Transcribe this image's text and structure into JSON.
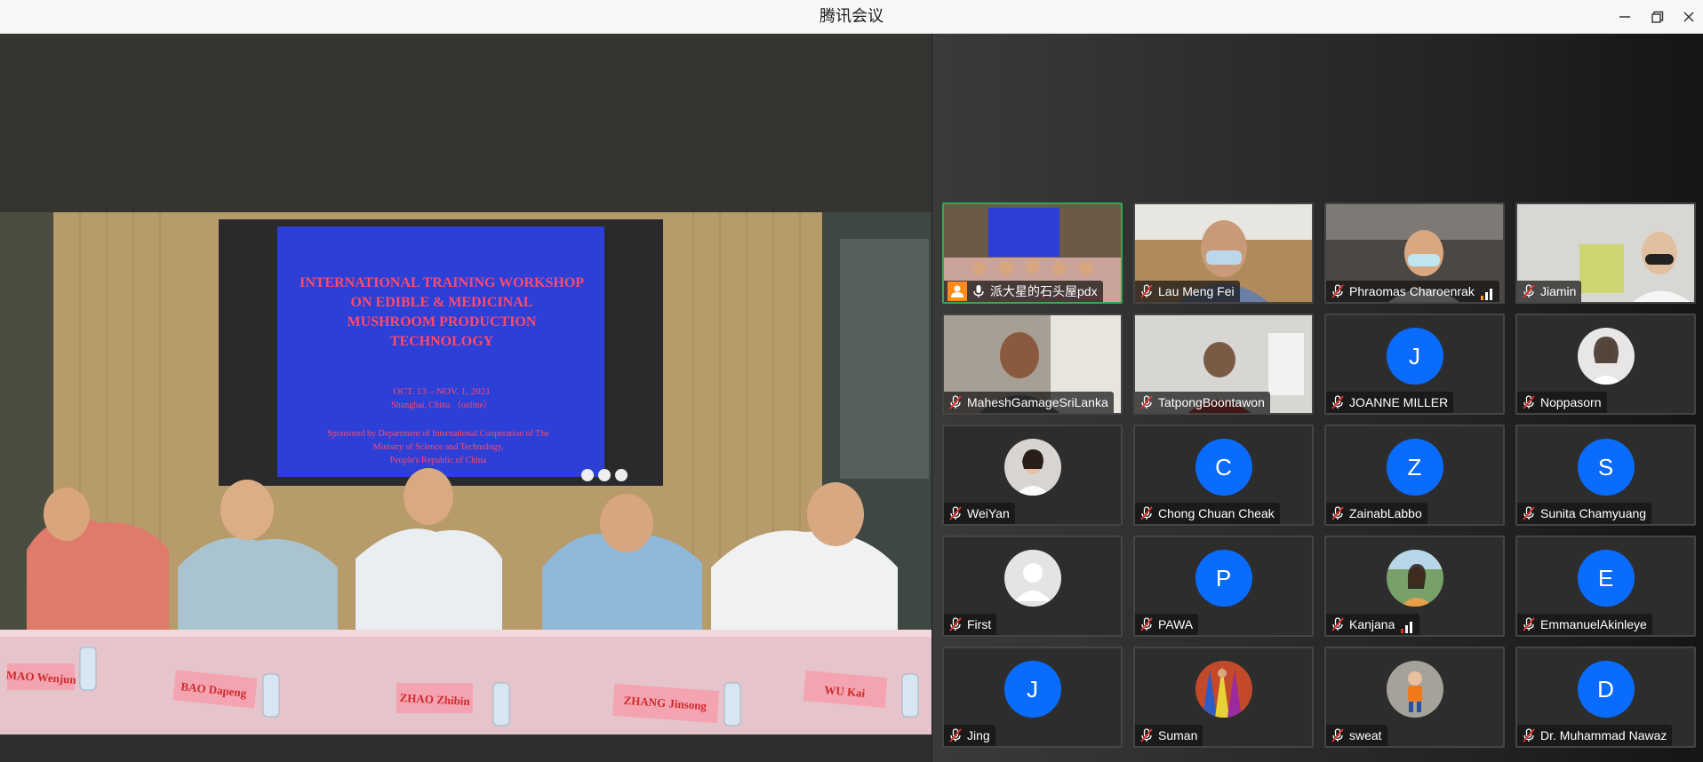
{
  "window": {
    "title": "腾讯会议"
  },
  "slide": {
    "title_lines": [
      "INTERNATIONAL TRAINING WORKSHOP",
      "ON EDIBLE & MEDICINAL",
      "MUSHROOM PRODUCTION",
      "TECHNOLOGY"
    ],
    "date": "OCT. 13 – NOV. 1, 2021",
    "location": "Shanghai, China （online）",
    "sponsor_lines": [
      "Sponsored by Department of International Cooperation of The",
      "Ministry of Science and Technology,",
      "People's Republic of China"
    ]
  },
  "nameplates": [
    "MAO Wenjun",
    "BAO Dapeng",
    "ZHAO Zhibin",
    "ZHANG Jinsong",
    "WU Kai"
  ],
  "participants": [
    {
      "name": "派大星的石头屋pdx",
      "type": "video",
      "host": true,
      "mic": "on",
      "active": true
    },
    {
      "name": "Lau Meng Fei",
      "type": "video",
      "mic": "muted"
    },
    {
      "name": "Phraomas Charoenrak",
      "type": "video",
      "mic": "muted",
      "signal": "orange"
    },
    {
      "name": "Jiamin",
      "type": "video",
      "mic": "muted"
    },
    {
      "name": "MaheshGamageSriLanka",
      "type": "video",
      "mic": "muted"
    },
    {
      "name": "TatpongBoontawon",
      "type": "video",
      "mic": "muted"
    },
    {
      "name": "JOANNE MILLER",
      "type": "avatar",
      "initial": "J",
      "mic": "muted"
    },
    {
      "name": "Noppasorn",
      "type": "photo",
      "mic": "muted"
    },
    {
      "name": "WeiYan",
      "type": "photo",
      "mic": "muted"
    },
    {
      "name": "Chong Chuan Cheak",
      "type": "avatar",
      "initial": "C",
      "mic": "muted"
    },
    {
      "name": "ZainabLabbo",
      "type": "avatar",
      "initial": "Z",
      "mic": "muted"
    },
    {
      "name": "Sunita Chamyuang",
      "type": "avatar",
      "initial": "S",
      "mic": "muted"
    },
    {
      "name": "First",
      "type": "photo",
      "mic": "muted"
    },
    {
      "name": "PAWA",
      "type": "avatar",
      "initial": "P",
      "mic": "muted"
    },
    {
      "name": "Kanjana",
      "type": "photo",
      "mic": "muted",
      "signal": "red"
    },
    {
      "name": "EmmanuelAkinleye",
      "type": "avatar",
      "initial": "E",
      "mic": "muted"
    },
    {
      "name": "Jing",
      "type": "avatar",
      "initial": "J",
      "mic": "muted"
    },
    {
      "name": "Suman",
      "type": "photo",
      "mic": "muted"
    },
    {
      "name": "sweat",
      "type": "photo",
      "mic": "muted"
    },
    {
      "name": "Dr. Muhammad Nawaz",
      "type": "avatar",
      "initial": "D",
      "mic": "muted"
    }
  ],
  "icons": {
    "minimize": "minimize-icon",
    "restore": "restore-icon",
    "close": "close-icon",
    "mic_muted": "mic-muted-icon",
    "mic_on": "mic-icon",
    "host": "host-icon",
    "signal": "signal-icon"
  },
  "colors": {
    "avatar_blue": "#0a6cff",
    "active_border": "#36a852",
    "slide_bg": "#2c3fd6",
    "slide_text": "#ff4a6a",
    "muted_red": "#e4322b"
  }
}
